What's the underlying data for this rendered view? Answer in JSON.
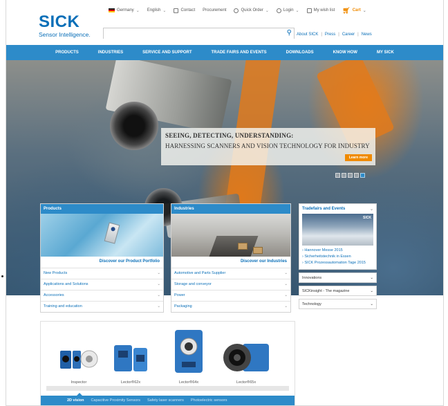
{
  "topbar": {
    "country": "Germany",
    "language": "English",
    "contact": "Contact",
    "procurement": "Procurement",
    "quick_order": "Quick Order",
    "login": "Login",
    "wishlist": "My wish list",
    "cart": "Cart"
  },
  "logo": {
    "word": "SICK",
    "tagline": "Sensor Intelligence."
  },
  "search": {
    "placeholder": "",
    "value": ""
  },
  "header_links": [
    "About SICK",
    "Press",
    "Career",
    "News"
  ],
  "nav": [
    "PRODUCTS",
    "INDUSTRIES",
    "SERVICE AND SUPPORT",
    "TRADE FAIRS AND EVENTS",
    "DOWNLOADS",
    "KNOW HOW",
    "MY SICK"
  ],
  "hero": {
    "title": "SEEING, DETECTING, UNDERSTANDING:",
    "subtitle": "HARNESSING SCANNERS AND VISION TECHNOLOGY FOR INDUSTRY",
    "button": "Learn more",
    "slide_count": 5,
    "active_slide": 5
  },
  "products_card": {
    "title": "Products",
    "link": "Discover our Product Portfolio",
    "items": [
      "New Products",
      "Applications and Solutions",
      "Accessories",
      "Training and education"
    ]
  },
  "industries_card": {
    "title": "Industries",
    "link": "Discover our Industries",
    "items": [
      "Automotive and Parts Supplier",
      "Storage and conveyor",
      "Power",
      "Packaging"
    ]
  },
  "events": {
    "title": "Tradefairs and Events",
    "image_mark": "SICK",
    "items": [
      "Hannover Messe 2015",
      "Sicherheitstechnik in Essen",
      "SICK Prozessautomation Tage 2015"
    ]
  },
  "side_rows": [
    "Innovations",
    "SICKinsight - The magazine",
    "Technology"
  ],
  "product_strip": {
    "products": [
      "Inspector",
      "Lector®62x",
      "Lector®64x",
      "Lector®65x"
    ],
    "tabs": [
      "2D vision",
      "Capacitive Proximity Sensors",
      "Safety laser scanners",
      "Photoelectric sensors"
    ],
    "active_tab": 0
  },
  "colors": {
    "brand_blue": "#2d8bc9",
    "link_blue": "#0a6fb8",
    "accent_orange": "#f08a00"
  }
}
